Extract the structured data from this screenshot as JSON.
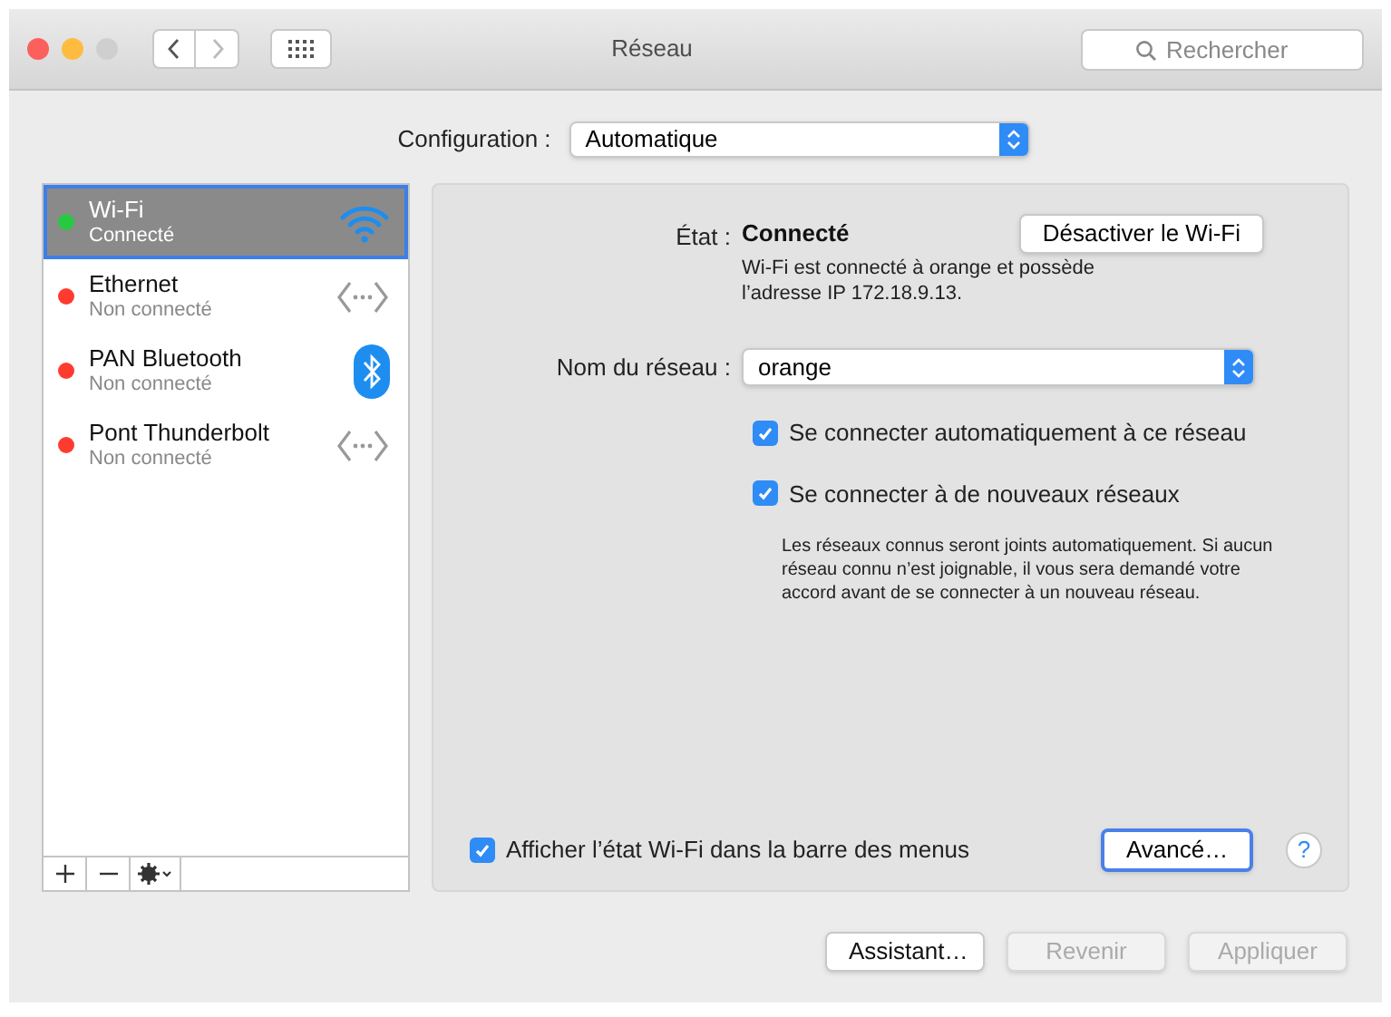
{
  "window": {
    "title": "Réseau"
  },
  "search": {
    "placeholder": "Rechercher"
  },
  "configuration": {
    "label": "Configuration :",
    "value": "Automatique"
  },
  "services": [
    {
      "name": "Wi-Fi",
      "status": "Connecté",
      "color": "#28c840",
      "kind": "wifi",
      "selected": true
    },
    {
      "name": "Ethernet",
      "status": "Non connecté",
      "color": "#ff3b30",
      "kind": "ethernet",
      "selected": false
    },
    {
      "name": "PAN Bluetooth",
      "status": "Non connecté",
      "color": "#ff3b30",
      "kind": "bluetooth",
      "selected": false
    },
    {
      "name": "Pont Thunderbolt",
      "status": "Non connecté",
      "color": "#ff3b30",
      "kind": "ethernet",
      "selected": false
    }
  ],
  "detail": {
    "state_label": "État :",
    "state_value": "Connecté",
    "toggle_button": "Désactiver le Wi-Fi",
    "state_description": "Wi-Fi est connecté à orange et possède l’adresse IP 172.18.9.13.",
    "network_label": "Nom du réseau :",
    "network_value": "orange",
    "options": [
      {
        "label": "Se connecter automatiquement à ce réseau",
        "checked": true
      },
      {
        "label": "Se connecter à de nouveaux réseaux",
        "checked": true
      }
    ],
    "note": "Les réseaux connus seront joints automatiquement. Si aucun réseau connu n’est joignable, il vous sera demandé votre accord avant de se connecter à un nouveau réseau.",
    "show_status": {
      "label": "Afficher l’état Wi-Fi dans la barre des menus",
      "checked": true
    },
    "advanced_button": "Avancé…",
    "help": "?"
  },
  "buttons": [
    {
      "label": "Assistant…",
      "disabled": false
    },
    {
      "label": "Revenir",
      "disabled": true
    },
    {
      "label": "Appliquer",
      "disabled": true
    }
  ]
}
